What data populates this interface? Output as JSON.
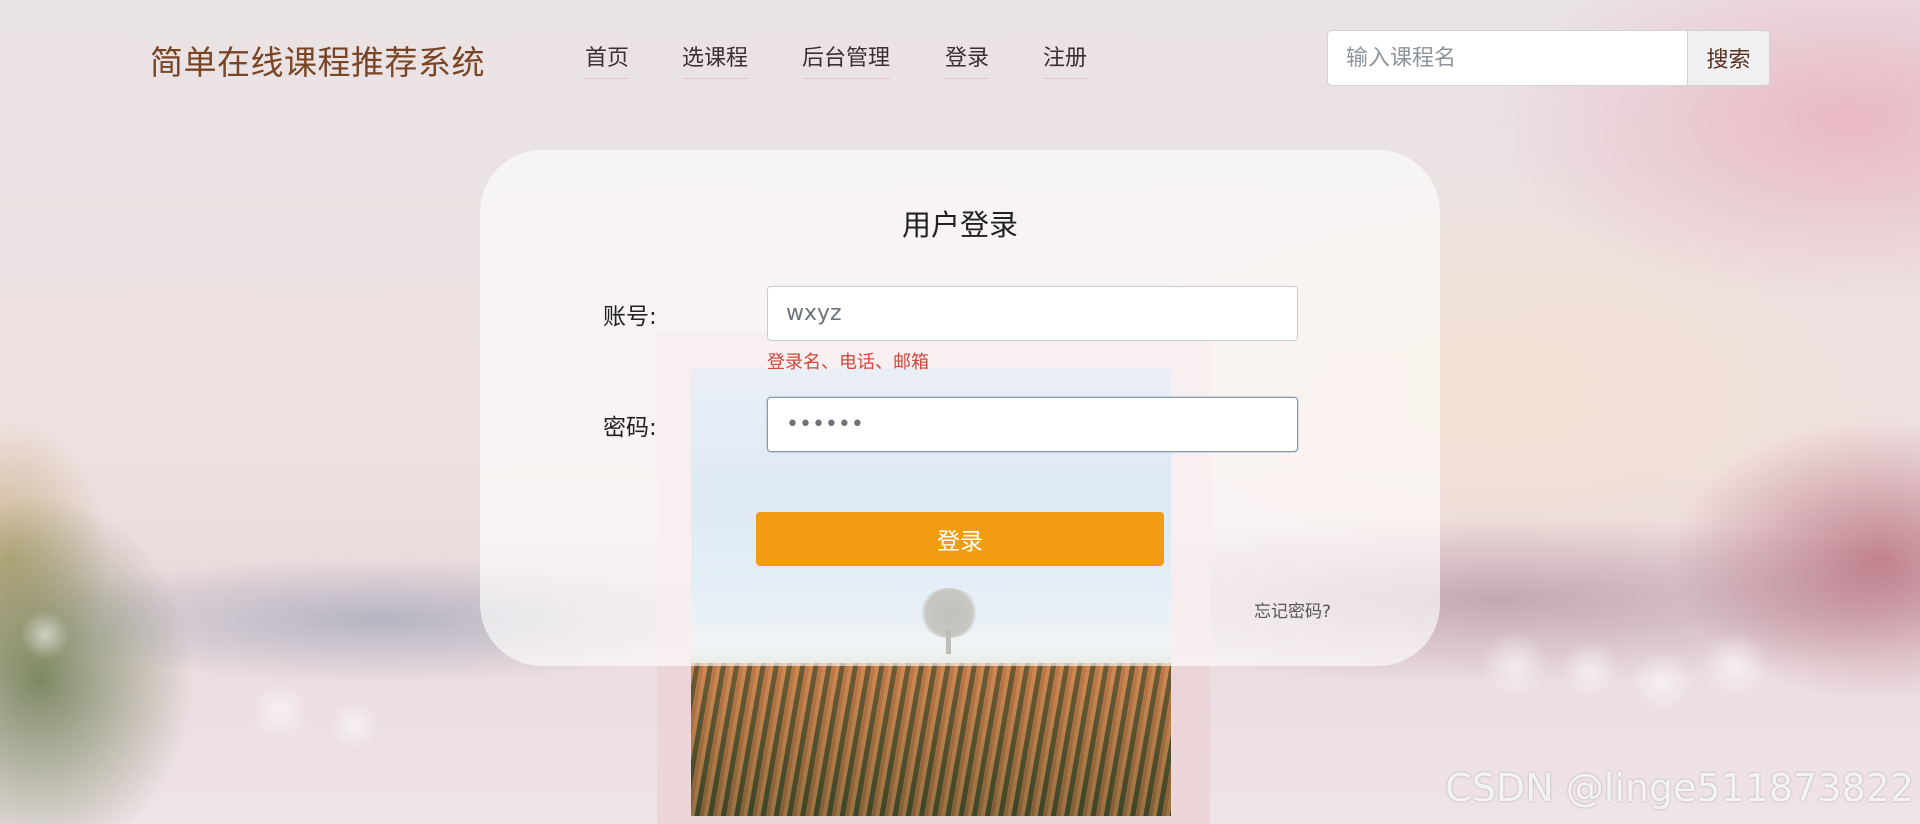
{
  "header": {
    "brand": "简单在线课程推荐系统",
    "nav": [
      {
        "label": "首页"
      },
      {
        "label": "选课程"
      },
      {
        "label": "后台管理"
      },
      {
        "label": "登录"
      },
      {
        "label": "注册"
      }
    ],
    "search": {
      "placeholder": "输入课程名",
      "button_label": "搜索"
    }
  },
  "login_form": {
    "title": "用户登录",
    "account_label": "账号:",
    "account_value": "wxyz",
    "account_hint": "登录名、电话、邮箱",
    "password_label": "密码:",
    "password_value": "••••••",
    "submit_label": "登录",
    "forgot_label": "忘记密码?"
  },
  "colors": {
    "brand": "#7a4524",
    "submit_button": "#f39c12",
    "hint": "#d0473c"
  },
  "watermark": "CSDN @linge511873822"
}
